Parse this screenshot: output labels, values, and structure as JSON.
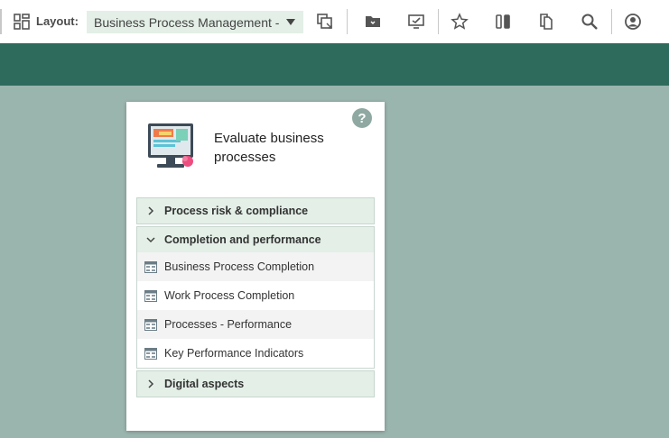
{
  "toolbar": {
    "layout_label": "Layout:",
    "layout_value": "Business Process Management - I..."
  },
  "card": {
    "title": "Evaluate business processes",
    "help": "?"
  },
  "sections": [
    {
      "label": "Process risk & compliance",
      "expanded": false
    },
    {
      "label": "Completion and performance",
      "expanded": true,
      "items": [
        {
          "label": "Business Process Completion"
        },
        {
          "label": "Work Process Completion"
        },
        {
          "label": "Processes - Performance"
        },
        {
          "label": "Key Performance Indicators"
        }
      ]
    },
    {
      "label": "Digital aspects",
      "expanded": false
    }
  ],
  "colors": {
    "banner": "#2e6b5c",
    "background": "#9ab4ae",
    "accordion_header": "#e3efe7"
  }
}
